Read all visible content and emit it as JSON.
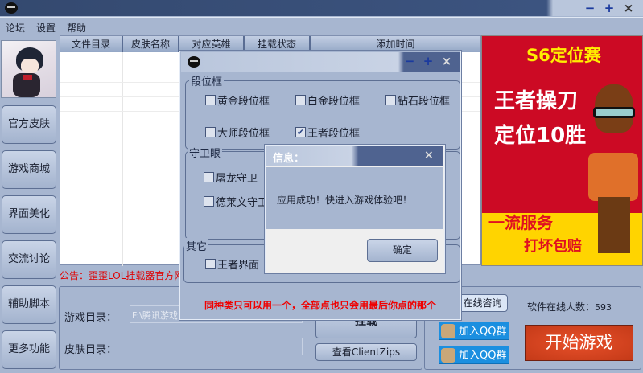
{
  "window": {
    "min": "−",
    "max": "+",
    "close": "×"
  },
  "menu": [
    "论坛",
    "设置",
    "帮助"
  ],
  "sidebar": [
    "官方皮肤",
    "游戏商城",
    "界面美化",
    "交流讨论",
    "辅助脚本",
    "更多功能"
  ],
  "table": {
    "columns": [
      "文件目录",
      "皮肤名称",
      "对应英雄",
      "挂载状态",
      "添加时间"
    ]
  },
  "notice": "公告：歪歪LOL挂载器官方网",
  "bottom": {
    "game_dir_label": "游戏目录：",
    "game_dir_value": "F:\\腾讯游戏",
    "skin_dir_label": "皮肤目录：",
    "skin_dir_value": "",
    "mount_button": "挂载",
    "view_zips_button": "查看ClientZips"
  },
  "right": {
    "consult": "在线咨询",
    "online_label": "软件在线人数：",
    "online_count": "593",
    "qq1": "加入QQ群",
    "qq2": "加入QQ群",
    "start": "开始游戏"
  },
  "ad": {
    "line1": "S6定位赛",
    "line2": "王者操刀",
    "line3": "定位10胜",
    "line4": "一流服务",
    "line5": "打坏包赔",
    "colors": {
      "red": "#cc0a24",
      "yellow": "#ffd400"
    }
  },
  "dialog": {
    "groups": [
      {
        "label": "段位框",
        "items": [
          {
            "label": "黄金段位框",
            "checked": false
          },
          {
            "label": "白金段位框",
            "checked": false
          },
          {
            "label": "钻石段位框",
            "checked": false
          },
          {
            "label": "大师段位框",
            "checked": false
          },
          {
            "label": "王者段位框",
            "checked": true
          }
        ]
      },
      {
        "label": "守卫眼",
        "items": [
          {
            "label": "屠龙守卫",
            "checked": false
          },
          {
            "label": "德莱文守卫",
            "checked": false
          }
        ]
      },
      {
        "label": "其它",
        "items": [
          {
            "label": "王者界面",
            "checked": false
          }
        ]
      }
    ],
    "footer": "同种类只可以用一个，全部点也只会用最后你点的那个",
    "check_mark": "✔"
  },
  "message": {
    "title": "信息：",
    "text": "应用成功！快进入游戏体验吧！",
    "ok": "确定",
    "close": "×"
  }
}
